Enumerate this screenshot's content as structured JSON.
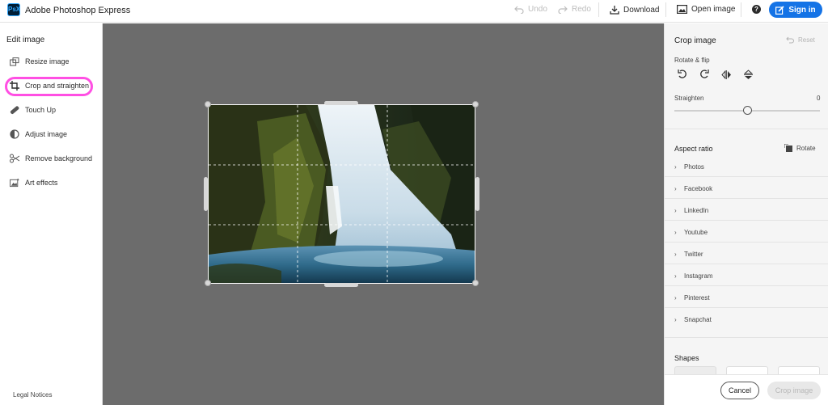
{
  "app": {
    "title": "Adobe Photoshop Express",
    "logo_text": "PsX"
  },
  "toolbar": {
    "undo_label": "Undo",
    "redo_label": "Redo",
    "download_label": "Download",
    "open_image_label": "Open image",
    "help_symbol": "?",
    "sign_in_label": "Sign in"
  },
  "sidebar": {
    "title": "Edit image",
    "items": [
      {
        "label": "Resize image",
        "icon": "resize-icon"
      },
      {
        "label": "Crop and straighten",
        "icon": "crop-icon",
        "highlighted": true
      },
      {
        "label": "Touch Up",
        "icon": "bandage-icon"
      },
      {
        "label": "Adjust image",
        "icon": "adjust-icon"
      },
      {
        "label": "Remove background",
        "icon": "scissors-icon"
      },
      {
        "label": "Art effects",
        "icon": "art-effects-icon"
      }
    ],
    "legal": "Legal Notices"
  },
  "panel": {
    "title": "Crop image",
    "reset_label": "Reset",
    "rotate_flip_label": "Rotate & flip",
    "straighten_label": "Straighten",
    "straighten_value": "0",
    "aspect_ratio_title": "Aspect ratio",
    "aspect_rotate_label": "Rotate",
    "aspect_items": [
      "Photos",
      "Facebook",
      "LinkedIn",
      "Youtube",
      "Twitter",
      "Instagram",
      "Pinterest",
      "Snapchat"
    ],
    "shapes_title": "Shapes",
    "cancel_label": "Cancel",
    "crop_label": "Crop image"
  },
  "colors": {
    "accent": "#1473e6",
    "highlight_ring": "#ff4fe3",
    "canvas_bg": "#6c6c6c"
  }
}
